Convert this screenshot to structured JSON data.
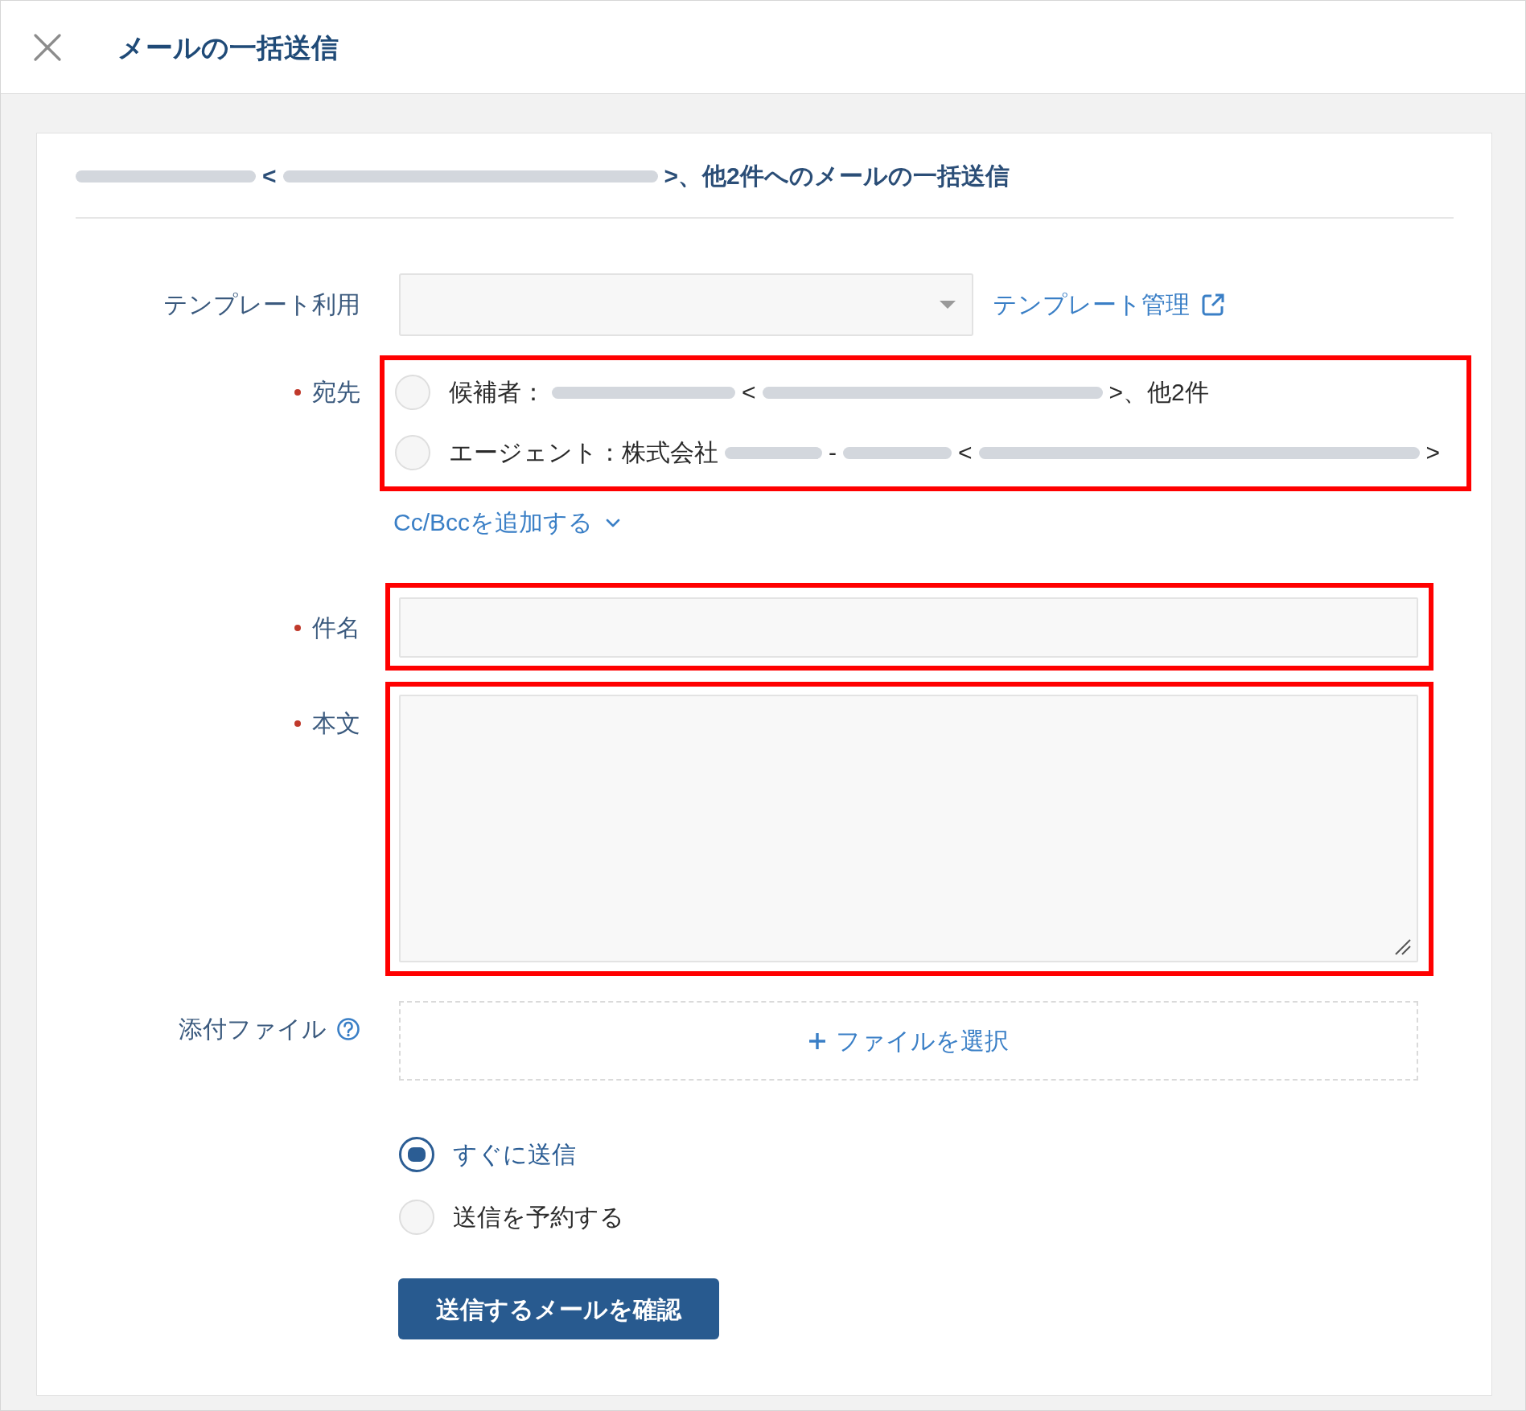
{
  "window": {
    "title": "メールの一括送信"
  },
  "heading": {
    "parts": [
      {
        "kind": "redacted"
      },
      {
        "kind": "text",
        "text": "<"
      },
      {
        "kind": "redacted"
      },
      {
        "kind": "text",
        "text": ">、他2件へのメールの一括送信"
      }
    ]
  },
  "template": {
    "label": "テンプレート利用",
    "required": false,
    "link": "テンプレート管理"
  },
  "recipients": {
    "label": "宛先",
    "required": true,
    "highlighted": true,
    "options": [
      {
        "selected": false,
        "parts": [
          {
            "kind": "text",
            "text": "候補者："
          },
          {
            "kind": "redacted"
          },
          {
            "kind": "text",
            "text": "<"
          },
          {
            "kind": "redacted"
          },
          {
            "kind": "text",
            "text": ">、他2件"
          }
        ]
      },
      {
        "selected": false,
        "parts": [
          {
            "kind": "text",
            "text": "エージェント：株式会社"
          },
          {
            "kind": "redacted"
          },
          {
            "kind": "text",
            "text": "-"
          },
          {
            "kind": "redacted"
          },
          {
            "kind": "text",
            "text": "<"
          },
          {
            "kind": "redacted"
          },
          {
            "kind": "text",
            "text": ">"
          }
        ]
      }
    ]
  },
  "cc_bcc_link": "Cc/Bccを追加する",
  "subject": {
    "label": "件名",
    "required": true,
    "highlighted": true
  },
  "body": {
    "label": "本文",
    "required": true,
    "highlighted": true
  },
  "attachments": {
    "label": "添付ファイル",
    "required": false,
    "button": "ファイルを選択"
  },
  "send_timing": {
    "options": [
      {
        "label": "すぐに送信",
        "selected": true
      },
      {
        "label": "送信を予約する",
        "selected": false
      }
    ]
  },
  "confirm_button": "送信するメールを確認"
}
